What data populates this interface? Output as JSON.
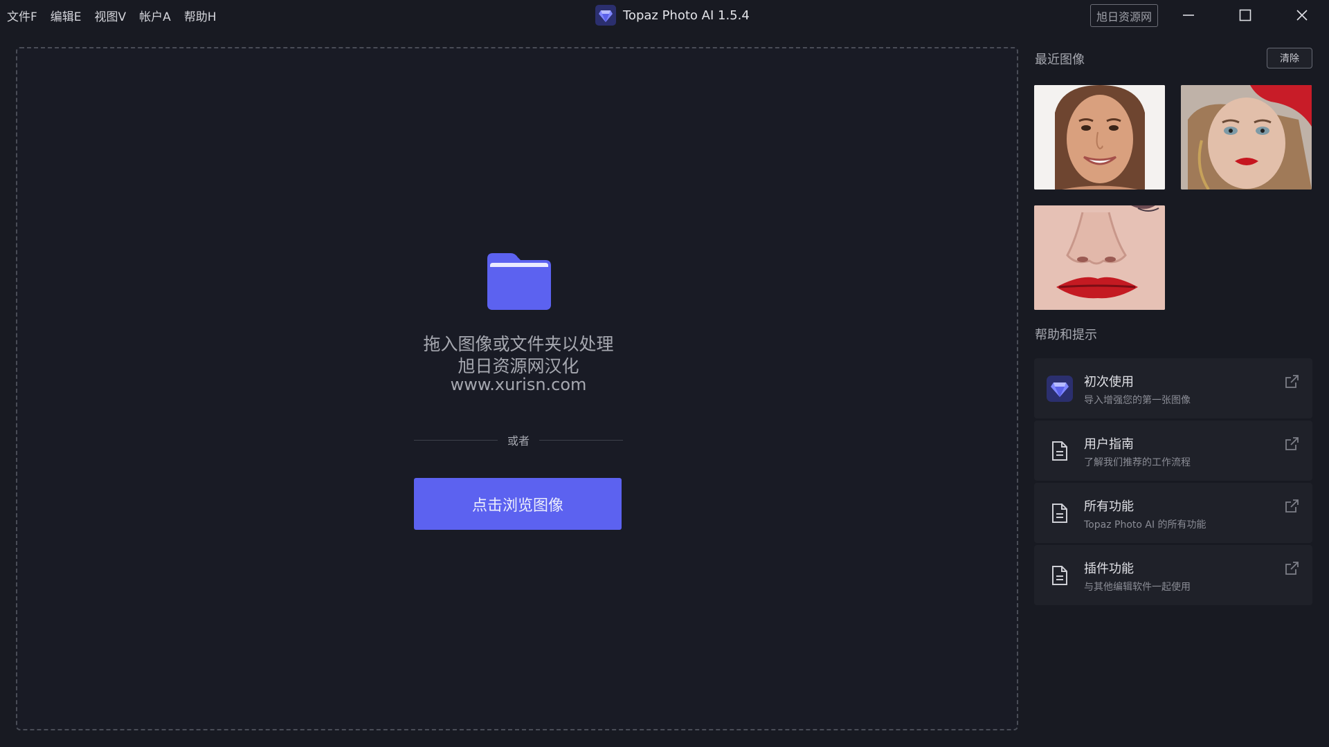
{
  "menu": {
    "items": [
      "文件F",
      "编辑E",
      "视图V",
      "帐户A",
      "帮助H"
    ]
  },
  "window": {
    "title": "Topaz Photo AI 1.5.4",
    "badge": "旭日资源网",
    "controls": [
      "minimize-icon",
      "maximize-icon",
      "close-icon"
    ]
  },
  "dropzone": {
    "icon": "folder-icon",
    "line1": "拖入图像或文件夹以处理",
    "line2": "旭日资源网汉化",
    "line3": "www.xurisn.com",
    "or_text": "或者",
    "browse_label": "点击浏览图像"
  },
  "recent": {
    "title": "最近图像",
    "clear_label": "清除",
    "thumbnails": [
      "smiling-woman-face",
      "woman-red-beret",
      "nose-red-lips-closeup"
    ]
  },
  "help": {
    "title": "帮助和提示",
    "items": [
      {
        "icon": "topaz-logo-icon",
        "name": "初次使用",
        "desc": "导入增强您的第一张图像"
      },
      {
        "icon": "document-icon",
        "name": "用户指南",
        "desc": "了解我们推荐的工作流程"
      },
      {
        "icon": "document-icon",
        "name": "所有功能",
        "desc": "Topaz Photo AI 的所有功能"
      },
      {
        "icon": "document-icon",
        "name": "插件功能",
        "desc": "与其他编辑软件一起使用"
      }
    ]
  },
  "colors": {
    "background": "#181a22",
    "accent": "#5c62f0",
    "card": "#1f2129"
  }
}
